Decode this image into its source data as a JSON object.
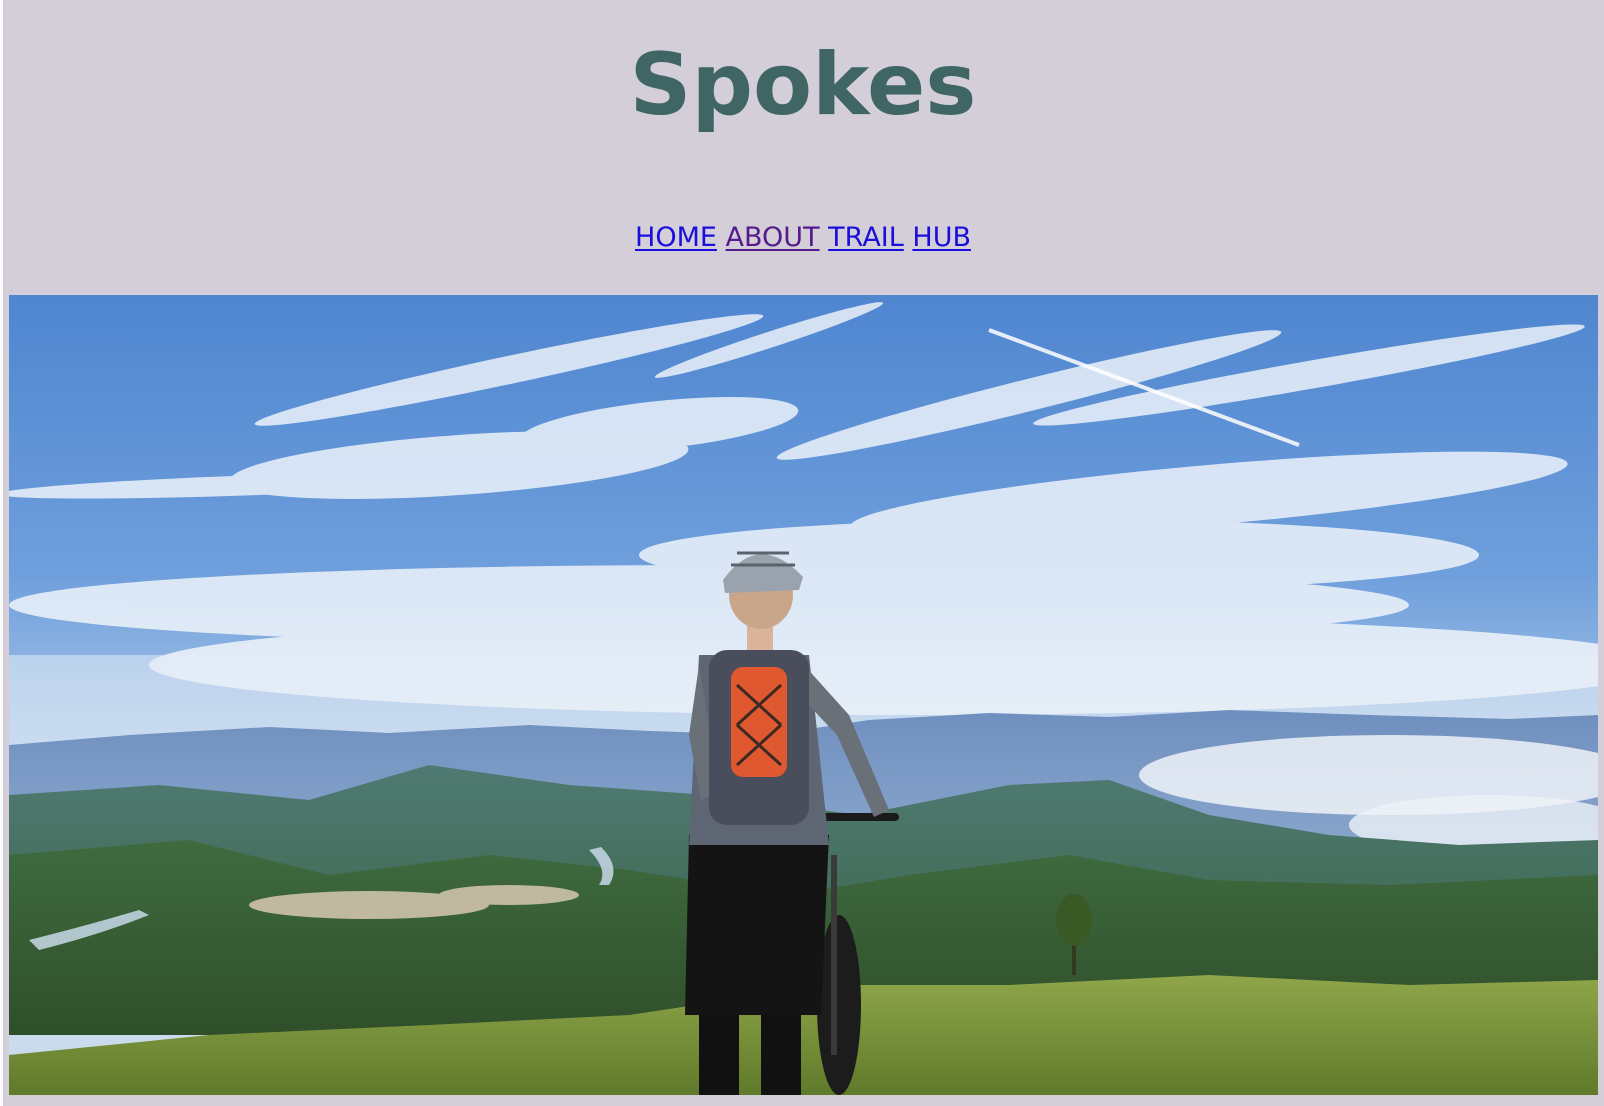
{
  "header": {
    "title": "Spokes"
  },
  "nav": {
    "items": [
      {
        "label": "HOME"
      },
      {
        "label": "ABOUT"
      },
      {
        "label": "TRAIL"
      },
      {
        "label": "HUB"
      }
    ]
  },
  "hero": {
    "icon": "mountain-biker-landscape-photo"
  },
  "colors": {
    "background": "#d3ced8",
    "title": "#3f6665",
    "link": "#1a0edc",
    "visited_link": "#551a8b"
  }
}
